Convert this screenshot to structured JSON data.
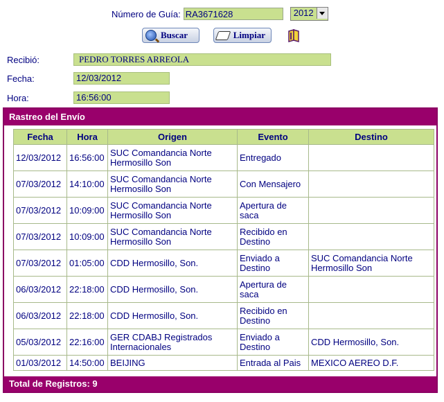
{
  "search": {
    "guia_label": "Número de Guía:",
    "guia_value": "RA3671628",
    "year_value": "2012",
    "buscar_label": "Buscar",
    "limpiar_label": "Limpiar"
  },
  "info": {
    "recibio_label": "Recibió:",
    "recibio_value": "PEDRO TORRES ARREOLA",
    "fecha_label": "Fecha:",
    "fecha_value": "12/03/2012",
    "hora_label": "Hora:",
    "hora_value": "16:56:00"
  },
  "tracking": {
    "title": "Rastreo del Envío",
    "columns": [
      "Fecha",
      "Hora",
      "Origen",
      "Evento",
      "Destino"
    ],
    "rows": [
      {
        "fecha": "12/03/2012",
        "hora": "16:56:00",
        "origen": "SUC Comandancia Norte Hermosillo Son",
        "evento": "Entregado",
        "destino": ""
      },
      {
        "fecha": "07/03/2012",
        "hora": "14:10:00",
        "origen": "SUC Comandancia Norte Hermosillo Son",
        "evento": "Con Mensajero",
        "destino": ""
      },
      {
        "fecha": "07/03/2012",
        "hora": "10:09:00",
        "origen": "SUC Comandancia Norte Hermosillo Son",
        "evento": "Apertura de saca",
        "destino": ""
      },
      {
        "fecha": "07/03/2012",
        "hora": "10:09:00",
        "origen": "SUC Comandancia Norte Hermosillo Son",
        "evento": "Recibido en Destino",
        "destino": ""
      },
      {
        "fecha": "07/03/2012",
        "hora": "01:05:00",
        "origen": "CDD Hermosillo, Son.",
        "evento": "Enviado a Destino",
        "destino": "SUC Comandancia Norte Hermosillo Son"
      },
      {
        "fecha": "06/03/2012",
        "hora": "22:18:00",
        "origen": "CDD Hermosillo, Son.",
        "evento": "Apertura de saca",
        "destino": ""
      },
      {
        "fecha": "06/03/2012",
        "hora": "22:18:00",
        "origen": "CDD Hermosillo, Son.",
        "evento": "Recibido en Destino",
        "destino": ""
      },
      {
        "fecha": "05/03/2012",
        "hora": "22:16:00",
        "origen": "GER CDABJ Registrados Internacionales",
        "evento": "Enviado a Destino",
        "destino": "CDD Hermosillo, Son."
      },
      {
        "fecha": "01/03/2012",
        "hora": "14:50:00",
        "origen": "BEIJING",
        "evento": "Entrada al Pais",
        "destino": "MEXICO AEREO D.F."
      }
    ],
    "footer": "Total de Registros: 9"
  },
  "icons": {
    "buscar": "search-icon",
    "limpiar": "eraser-icon",
    "extra": "book-icon"
  },
  "colors": {
    "field_bg": "#c9e08f",
    "panel": "#99006b",
    "text": "#000080"
  }
}
